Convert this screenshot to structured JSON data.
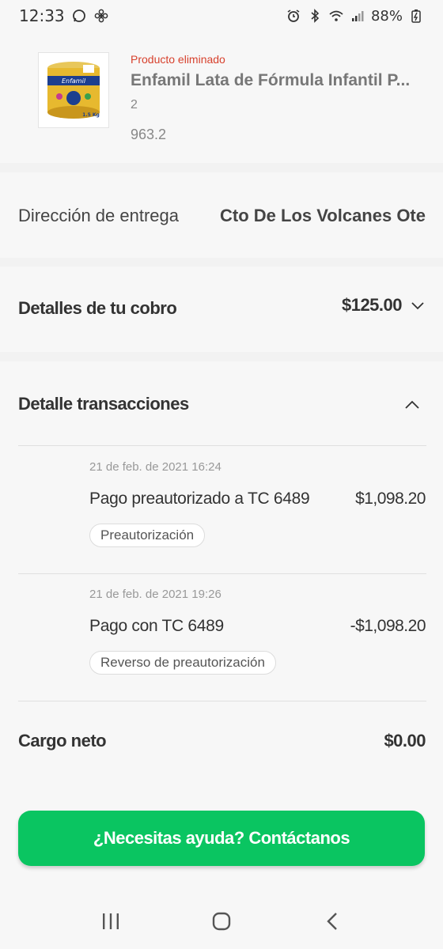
{
  "status_bar": {
    "time": "12:33",
    "battery": "88%"
  },
  "product": {
    "status": "Producto eliminado",
    "name": "Enfamil Lata de Fórmula Infantil P...",
    "quantity": "2",
    "price": "963.2",
    "image_label": "Enfamil",
    "image_sublabel": "1.5 Kg"
  },
  "address": {
    "label": "Dirección de entrega",
    "value": "Cto De Los Volcanes Ote"
  },
  "charge": {
    "label": "Detalles de tu cobro",
    "amount": "$125.00"
  },
  "transactions": {
    "title": "Detalle transacciones",
    "items": [
      {
        "date": "21 de feb. de 2021 16:24",
        "description": "Pago preautorizado a TC 6489",
        "amount": "$1,098.20",
        "badge": "Preautorización"
      },
      {
        "date": "21 de feb. de 2021 19:26",
        "description": "Pago con TC 6489",
        "amount": "-$1,098.20",
        "badge": "Reverso de preautorización"
      }
    ],
    "net_label": "Cargo neto",
    "net_value": "$0.00"
  },
  "help_button": "¿Necesitas ayuda? Contáctanos",
  "colors": {
    "accent_green": "#0ac561",
    "removed_red": "#d7412d"
  }
}
